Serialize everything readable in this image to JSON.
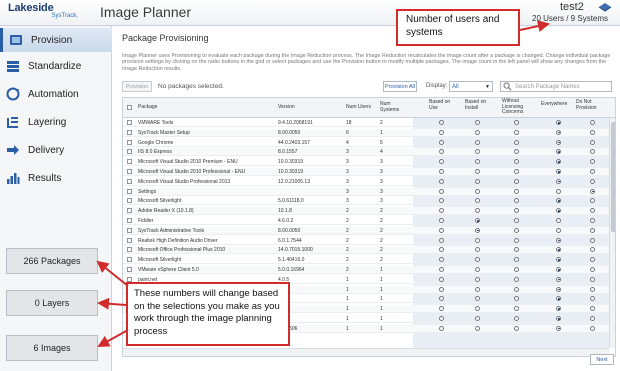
{
  "header": {
    "logo": "Lakeside",
    "logo_sub": "SysTrack.",
    "app_title": "Image Planner",
    "user_name": "test2",
    "user_stats": "20 Users / 9 Systems"
  },
  "sidebar": {
    "items": [
      {
        "label": "Provision",
        "icon": "provision-icon",
        "active": true
      },
      {
        "label": "Standardize",
        "icon": "standardize-icon"
      },
      {
        "label": "Automation",
        "icon": "automation-icon"
      },
      {
        "label": "Layering",
        "icon": "layering-icon"
      },
      {
        "label": "Delivery",
        "icon": "delivery-icon"
      },
      {
        "label": "Results",
        "icon": "results-icon"
      }
    ],
    "counts": {
      "packages": "266 Packages",
      "layers": "0 Layers",
      "images": "6 Images"
    }
  },
  "main": {
    "section_title": "Package Provisioning",
    "description": "Image Planner uses Provisioning to evaluate each package during the Image Reduction process. The Image Reduction recalculates the image count after a package is changed. Change individual package provision settings by clicking on the radio buttons in the grid or select packages and use the Provision button to modify multiple packages. The image count in the left panel will show any changes from the Image Reduction results.",
    "toolbar": {
      "provision_button": "Provision",
      "selection_status": "No packages selected.",
      "provision_all_button": "Provision All",
      "display_label": "Display:",
      "display_value": "All",
      "search_placeholder": "Search Package Names"
    },
    "columns": [
      "Package",
      "Version",
      "Num Users",
      "Num Systems",
      "Based on Use",
      "Based on Install",
      "Without Licensing Concerns",
      "Everywhere",
      "Do Not Provision"
    ],
    "rows": [
      {
        "package": "VMWARE Tools",
        "version": "9.4.10.2068191",
        "users": "18",
        "systems": "2",
        "choice": 3
      },
      {
        "package": "SysTrack Master Setup",
        "version": "8.00.0050",
        "users": "6",
        "systems": "1",
        "choice": 3
      },
      {
        "package": "Google Chrome",
        "version": "44.0.2403.157",
        "users": "4",
        "systems": "5",
        "choice": 3
      },
      {
        "package": "IIS 8.0 Express",
        "version": "8.0.1557",
        "users": "3",
        "systems": "4",
        "choice": 3
      },
      {
        "package": "Microsoft Visual Studio 2010 Premium - ENU",
        "version": "10.0.30319",
        "users": "3",
        "systems": "3",
        "choice": 3
      },
      {
        "package": "Microsoft Visual Studio 2010 Professional - ENU",
        "version": "10.0.30319",
        "users": "3",
        "systems": "3",
        "choice": 3
      },
      {
        "package": "Microsoft Visual Studio Professional 2013",
        "version": "12.0.21005.13",
        "users": "3",
        "systems": "3",
        "choice": 3
      },
      {
        "package": "Settings",
        "version": "",
        "users": "3",
        "systems": "3",
        "choice": 4
      },
      {
        "package": "Microsoft Silverlight",
        "version": "5.0.61118.0",
        "users": "3",
        "systems": "3",
        "choice": 3
      },
      {
        "package": "Adobe Reader X (10.1.8)",
        "version": "10.1.8",
        "users": "2",
        "systems": "2",
        "choice": 3
      },
      {
        "package": "Fiddler",
        "version": "4.6.0.2",
        "users": "2",
        "systems": "2",
        "choice": 1
      },
      {
        "package": "SysTrack Administrative Tools",
        "version": "8.00.0050",
        "users": "2",
        "systems": "2",
        "choice": 1
      },
      {
        "package": "Realtek High Definition Audio Driver",
        "version": "6.0.1.7544",
        "users": "2",
        "systems": "2",
        "choice": 3
      },
      {
        "package": "Microsoft Office Professional Plus 2010",
        "version": "14.0.7015.1000",
        "users": "2",
        "systems": "2",
        "choice": 3
      },
      {
        "package": "Microsoft Silverlight",
        "version": "5.1.40416.0",
        "users": "2",
        "systems": "2",
        "choice": 3
      },
      {
        "package": "VMware vSphere Client 5.0",
        "version": "5.0.0.16964",
        "users": "2",
        "systems": "1",
        "choice": 3
      },
      {
        "package": "paint.net",
        "version": "4.0.5",
        "users": "1",
        "systems": "1",
        "choice": 3
      },
      {
        "package": "",
        "version": "",
        "users": "1",
        "systems": "1",
        "choice": 3
      },
      {
        "package": "",
        "version": "",
        "users": "1",
        "systems": "1",
        "choice": 3
      },
      {
        "package": "",
        "version": "",
        "users": "1",
        "systems": "1",
        "choice": 3
      },
      {
        "package": "",
        "version": "",
        "users": "1",
        "systems": "1",
        "choice": 3
      },
      {
        "package": "",
        "version": ".69.1506",
        "users": "1",
        "systems": "1",
        "choice": 3
      }
    ],
    "next_button": "Next"
  },
  "callouts": {
    "top": "Number of users and systems",
    "bottom": "These numbers will change based on the selections you make as you work through the image planning process"
  },
  "colors": {
    "accent": "#2a5ea5",
    "callout_border": "#d22b2b",
    "arrow": "#d22b2b"
  }
}
